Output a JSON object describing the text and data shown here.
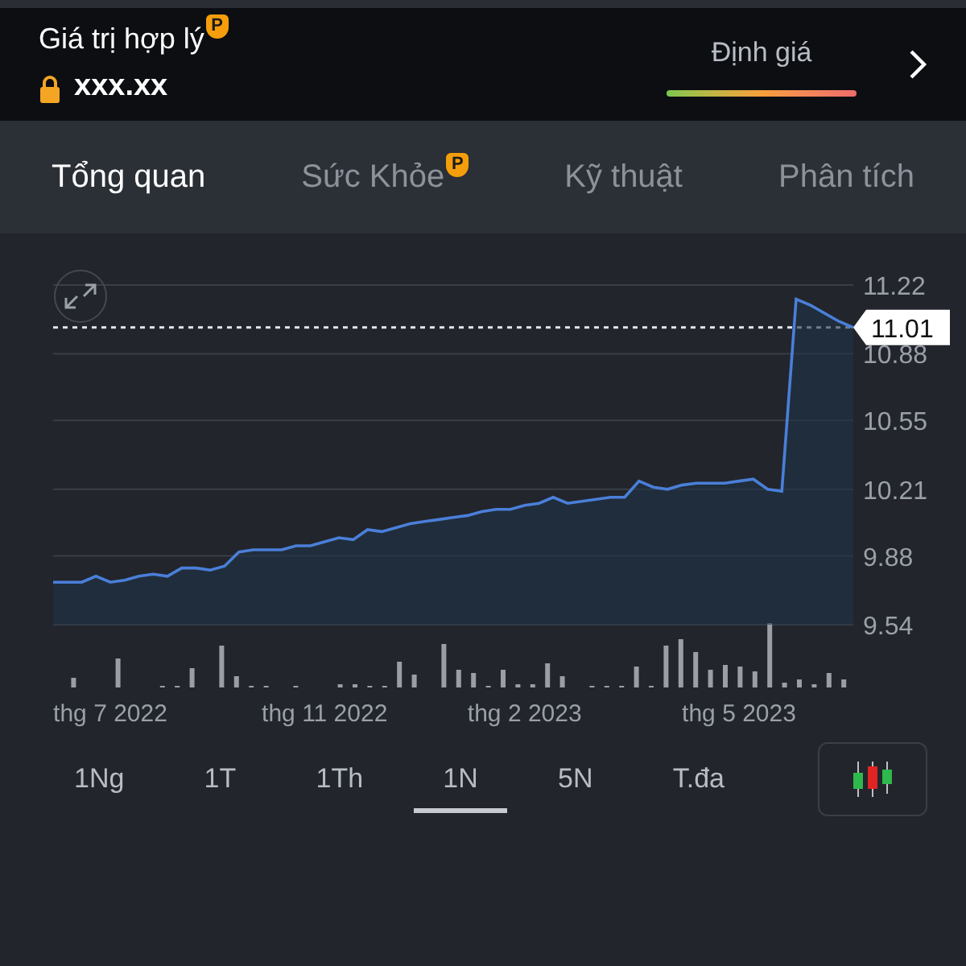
{
  "header": {
    "title": "Giá trị hợp lý",
    "title_badge": "P",
    "value": "xxx.xx",
    "locked": true,
    "rating_label": "Định giá"
  },
  "tabs": [
    {
      "label": "Tổng quan",
      "selected": true
    },
    {
      "label": "Sức Khỏe",
      "selected": false,
      "badge": "P"
    },
    {
      "label": "Kỹ thuật",
      "selected": false
    },
    {
      "label": "Phân tích",
      "selected": false
    }
  ],
  "chart": {
    "chart_data": {
      "type": "area",
      "grid": true,
      "ylim": [
        9.54,
        11.22
      ],
      "yticks": [
        9.54,
        9.88,
        10.21,
        10.55,
        10.88,
        11.22
      ],
      "categories": [
        null,
        null,
        null,
        null,
        "thg 7 2022",
        null,
        null,
        null,
        null,
        null,
        null,
        null,
        null,
        null,
        null,
        null,
        null,
        null,
        null,
        "thg 11 2022",
        null,
        null,
        null,
        null,
        null,
        null,
        null,
        null,
        null,
        null,
        null,
        null,
        null,
        "thg 2 2023",
        null,
        null,
        null,
        null,
        null,
        null,
        null,
        null,
        null,
        null,
        null,
        null,
        null,
        null,
        "thg 5 2023",
        null,
        null,
        null,
        null,
        null,
        null,
        null,
        null
      ],
      "ref_lines": [
        {
          "axis": "y",
          "value": 11.01,
          "label": "11.01"
        }
      ],
      "series": [
        {
          "color": "#4a7fd9",
          "values": [
            9.75,
            9.75,
            9.75,
            9.78,
            9.75,
            9.76,
            9.78,
            9.79,
            9.78,
            9.82,
            9.82,
            9.81,
            9.83,
            9.9,
            9.91,
            9.91,
            9.91,
            9.93,
            9.93,
            9.95,
            9.97,
            9.96,
            10.01,
            10.0,
            10.02,
            10.04,
            10.05,
            10.06,
            10.07,
            10.08,
            10.1,
            10.11,
            10.11,
            10.13,
            10.14,
            10.17,
            10.14,
            10.15,
            10.16,
            10.17,
            10.17,
            10.25,
            10.22,
            10.21,
            10.23,
            10.24,
            10.24,
            10.24,
            10.25,
            10.26,
            10.21,
            10.2,
            11.15,
            11.12,
            11.08,
            11.04,
            11.01
          ]
        }
      ]
    }
  },
  "ranges": [
    {
      "label": "1Ng",
      "selected": false
    },
    {
      "label": "1T",
      "selected": false
    },
    {
      "label": "1Th",
      "selected": false
    },
    {
      "label": "1N",
      "selected": true
    },
    {
      "label": "5N",
      "selected": false
    },
    {
      "label": "T.đa",
      "selected": false
    }
  ]
}
